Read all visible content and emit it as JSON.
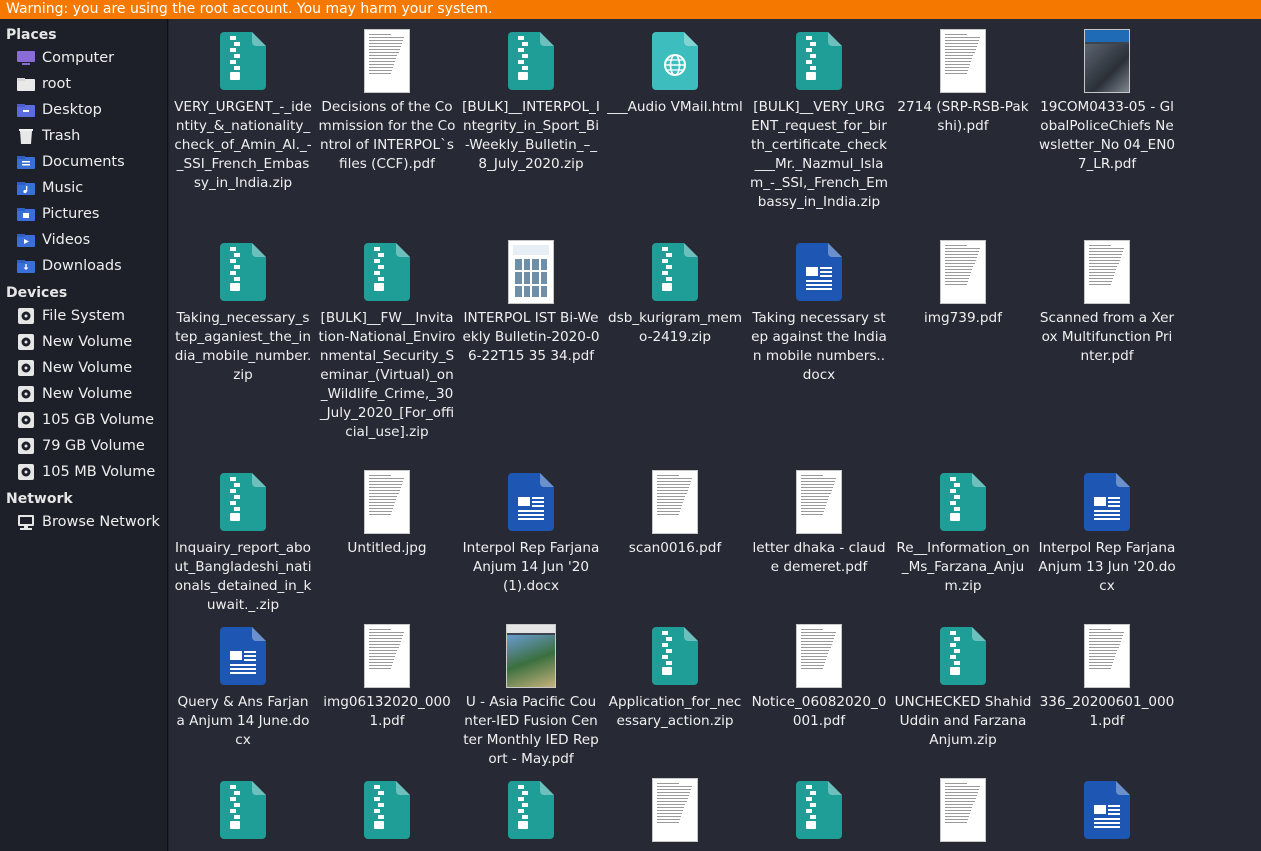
{
  "warning": "Warning: you are using the root account. You may harm your system.",
  "sidebar": {
    "places_title": "Places",
    "places": [
      {
        "label": "Computer",
        "icon": "computer-icon"
      },
      {
        "label": "root",
        "icon": "home-folder-icon"
      },
      {
        "label": "Desktop",
        "icon": "desktop-folder-icon"
      },
      {
        "label": "Trash",
        "icon": "trash-icon"
      },
      {
        "label": "Documents",
        "icon": "documents-folder-icon"
      },
      {
        "label": "Music",
        "icon": "music-folder-icon"
      },
      {
        "label": "Pictures",
        "icon": "pictures-folder-icon"
      },
      {
        "label": "Videos",
        "icon": "videos-folder-icon"
      },
      {
        "label": "Downloads",
        "icon": "downloads-folder-icon"
      }
    ],
    "devices_title": "Devices",
    "devices": [
      {
        "label": "File System",
        "icon": "drive-icon"
      },
      {
        "label": "New Volume",
        "icon": "drive-icon"
      },
      {
        "label": "New Volume",
        "icon": "drive-icon"
      },
      {
        "label": "New Volume",
        "icon": "drive-icon"
      },
      {
        "label": "105 GB Volume",
        "icon": "drive-icon"
      },
      {
        "label": "79 GB Volume",
        "icon": "drive-icon"
      },
      {
        "label": "105 MB Volume",
        "icon": "drive-icon"
      }
    ],
    "network_title": "Network",
    "network": [
      {
        "label": "Browse Network",
        "icon": "network-icon"
      }
    ]
  },
  "colors": {
    "warning_bg": "#f57900",
    "zip_teal": "#1f9e97",
    "docx_blue": "#1d57b3",
    "html_teal": "#3dbdbd"
  },
  "files": [
    {
      "name": "VERY_URGENT_-_identity_&_nationality_check_of_Amin_Al._-_SSI_French_Embassy_in_India.zip",
      "type": "zip"
    },
    {
      "name": "Decisions of the Commission for the Control of INTERPOL`s files (CCF).pdf",
      "type": "pdf"
    },
    {
      "name": "[BULK]__INTERPOL_Integrity_in_Sport_Bi-Weekly_Bulletin_–_8_July_2020.zip",
      "type": "zip"
    },
    {
      "name": "___Audio VMail.html",
      "type": "html"
    },
    {
      "name": "[BULK]__VERY_URGENT_request_for_birth_certificate_check___Mr._Nazmul_Islam_-_SSI,_French_Embassy_in_India.zip",
      "type": "zip"
    },
    {
      "name": "2714 (SRP-RSB-Pakshi).pdf",
      "type": "pdf"
    },
    {
      "name": "19COM0433-05 - GlobalPoliceChiefs Newsletter_No 04_EN07_LR.pdf",
      "type": "pdf-photo"
    },
    {
      "name": "Taking_necessary_step_aganiest_the_india_mobile_number.zip",
      "type": "zip"
    },
    {
      "name": "[BULK]__FW__Invitation-National_Environmental_Security_Seminar_(Virtual)_on_Wildlife_Crime,_30_July_2020_[For_official_use].zip",
      "type": "zip"
    },
    {
      "name": "INTERPOL IST Bi-Weekly Bulletin-2020-06-22T15 35 34.pdf",
      "type": "pdf-poster"
    },
    {
      "name": "dsb_kurigram_memo-2419.zip",
      "type": "zip"
    },
    {
      "name": "Taking necessary step against the Indian mobile numbers..docx",
      "type": "docx"
    },
    {
      "name": "img739.pdf",
      "type": "pdf"
    },
    {
      "name": "Scanned from a Xerox Multifunction Printer.pdf",
      "type": "pdf"
    },
    {
      "name": "Inquairy_report_about_Bangladeshi_nationals_detained_in_kuwait._.zip",
      "type": "zip"
    },
    {
      "name": "Untitled.jpg",
      "type": "pdf"
    },
    {
      "name": "Interpol Rep Farjana Anjum 14 Jun '20(1).docx",
      "type": "docx"
    },
    {
      "name": "scan0016.pdf",
      "type": "pdf"
    },
    {
      "name": "letter dhaka - claude demeret.pdf",
      "type": "pdf"
    },
    {
      "name": "Re__Information_on_Ms_Farzana_Anjum.zip",
      "type": "zip"
    },
    {
      "name": "Interpol Rep Farjana Anjum 13 Jun '20.docx",
      "type": "docx"
    },
    {
      "name": "Query & Ans Farjana Anjum 14 June.docx",
      "type": "docx"
    },
    {
      "name": "img06132020_0001.pdf",
      "type": "pdf"
    },
    {
      "name": "U - Asia Pacific Counter-IED Fusion Center Monthly IED Report - May.pdf",
      "type": "pdf-map"
    },
    {
      "name": "Application_for_necessary_action.zip",
      "type": "zip"
    },
    {
      "name": "Notice_06082020_0001.pdf",
      "type": "pdf"
    },
    {
      "name": "UNCHECKED Shahid Uddin and Farzana Anjum.zip",
      "type": "zip"
    },
    {
      "name": "336_20200601_0001.pdf",
      "type": "pdf"
    },
    {
      "name": "",
      "type": "zip"
    },
    {
      "name": "",
      "type": "zip"
    },
    {
      "name": "",
      "type": "zip"
    },
    {
      "name": "",
      "type": "pdf"
    },
    {
      "name": "",
      "type": "zip"
    },
    {
      "name": "",
      "type": "pdf"
    },
    {
      "name": "",
      "type": "docx"
    }
  ]
}
